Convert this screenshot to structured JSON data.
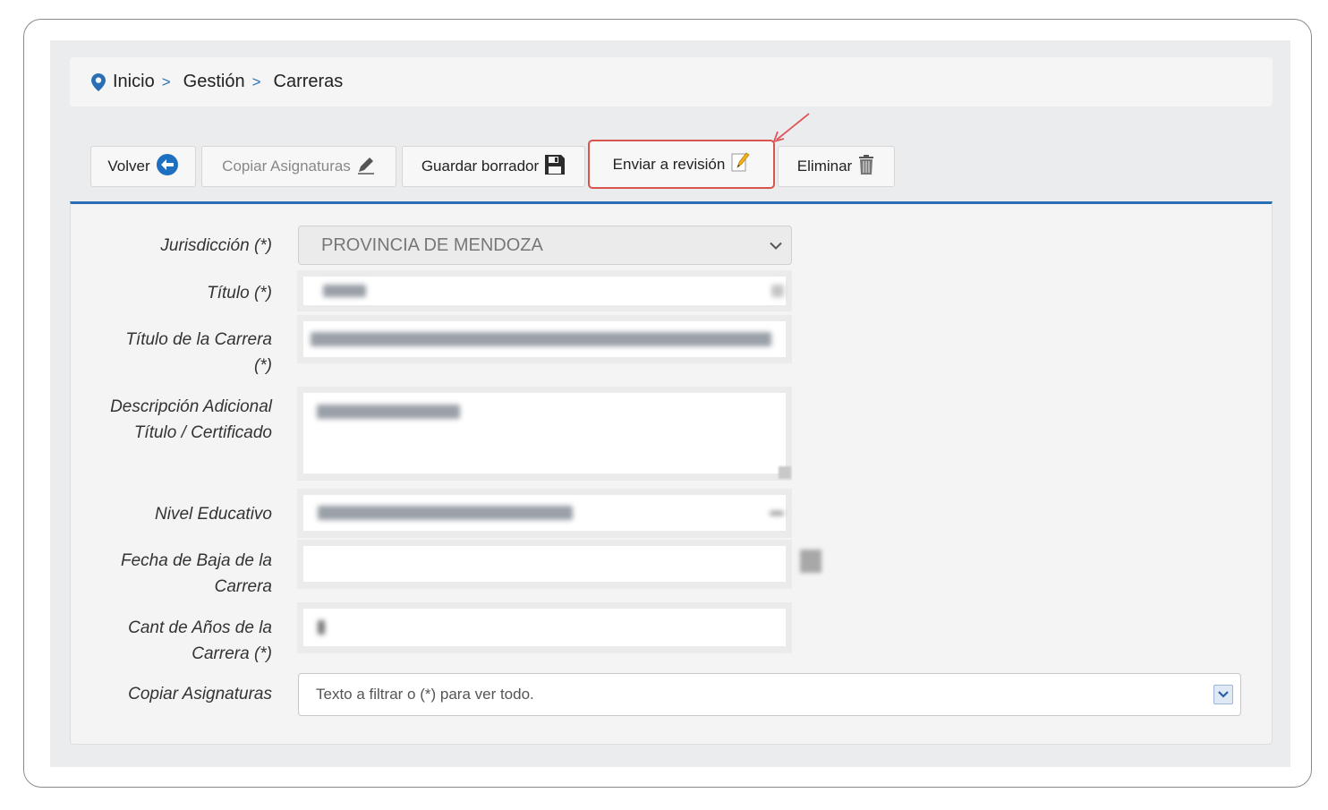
{
  "breadcrumb": {
    "items": [
      "Inicio",
      "Gestión",
      "Carreras"
    ],
    "separator": ">"
  },
  "toolbar": {
    "volver": "Volver",
    "copiar": "Copiar Asignaturas",
    "guardar": "Guardar borrador",
    "enviar": "Enviar a revisión",
    "eliminar": "Eliminar"
  },
  "form": {
    "jurisdiccion": {
      "label": "Jurisdicción (*)",
      "value": "PROVINCIA DE MENDOZA"
    },
    "titulo": {
      "label": "Título (*)"
    },
    "titulo_carrera": {
      "label_1": "Título de la Carrera",
      "label_2": "(*)"
    },
    "descripcion": {
      "label_1": "Descripción Adicional",
      "label_2": "Título / Certificado"
    },
    "nivel": {
      "label": "Nivel Educativo"
    },
    "fecha_baja": {
      "label_1": "Fecha de Baja de la",
      "label_2": "Carrera",
      "value": ""
    },
    "anios": {
      "label_1": "Cant de Años de la",
      "label_2": "Carrera (*)"
    },
    "copiar_asignaturas": {
      "label": "Copiar Asignaturas",
      "placeholder": "Texto a filtrar o (*) para ver todo."
    }
  },
  "colors": {
    "accent": "#2a6fb5",
    "highlight": "#d9534f"
  }
}
